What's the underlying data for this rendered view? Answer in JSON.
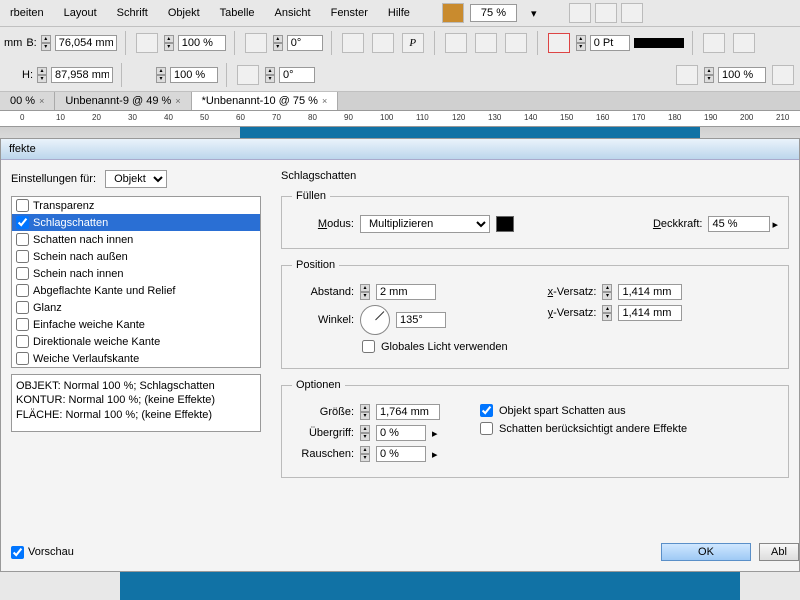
{
  "menu": [
    "rbeiten",
    "Layout",
    "Schrift",
    "Objekt",
    "Tabelle",
    "Ansicht",
    "Fenster",
    "Hilfe"
  ],
  "menubar_zoom": "75 %",
  "toolbar": {
    "B_label": "B:",
    "B_value": "76,054 mm",
    "H_label": "H:",
    "H_value": "87,958 mm",
    "mm_left": "mm",
    "scale1": "100 %",
    "scale2": "100 %",
    "rot1": "0°",
    "rot2": "0°",
    "stroke_pt": "0 Pt",
    "scale_r": "100 %"
  },
  "tabs": [
    {
      "label": "00 %",
      "active": false
    },
    {
      "label": "Unbenannt-9 @ 49 %",
      "active": false
    },
    {
      "label": "*Unbenannt-10 @ 75 %",
      "active": true
    }
  ],
  "dialog": {
    "title": "ffekte",
    "settings_for": "Einstellungen für:",
    "settings_target": "Objekt",
    "fx": [
      {
        "label": "Transparenz",
        "checked": false
      },
      {
        "label": "Schlagschatten",
        "checked": true,
        "selected": true
      },
      {
        "label": "Schatten nach innen",
        "checked": false
      },
      {
        "label": "Schein nach außen",
        "checked": false
      },
      {
        "label": "Schein nach innen",
        "checked": false
      },
      {
        "label": "Abgeflachte Kante und Relief",
        "checked": false
      },
      {
        "label": "Glanz",
        "checked": false
      },
      {
        "label": "Einfache weiche Kante",
        "checked": false
      },
      {
        "label": "Direktionale weiche Kante",
        "checked": false
      },
      {
        "label": "Weiche Verlaufskante",
        "checked": false
      }
    ],
    "summary1": "OBJEKT: Normal 100 %; Schlagschatten",
    "summary2": "KONTUR: Normal 100 %; (keine Effekte)",
    "summary3": "FLÄCHE: Normal 100 %; (keine Effekte)",
    "section_title": "Schlagschatten",
    "fill": {
      "legend": "Füllen",
      "mode_label": "Modus:",
      "mode_value": "Multiplizieren",
      "opacity_label": "Deckkraft:",
      "opacity_value": "45 %"
    },
    "position": {
      "legend": "Position",
      "distance_label": "Abstand:",
      "distance_value": "2 mm",
      "angle_label": "Winkel:",
      "angle_value": "135°",
      "global_light": "Globales Licht verwenden",
      "x_label": "x-Versatz:",
      "x_value": "1,414 mm",
      "y_label": "y-Versatz:",
      "y_value": "1,414 mm"
    },
    "options": {
      "legend": "Optionen",
      "size_label": "Größe:",
      "size_value": "1,764 mm",
      "spread_label": "Übergriff:",
      "spread_value": "0 %",
      "noise_label": "Rauschen:",
      "noise_value": "0 %",
      "knockout": "Objekt spart Schatten aus",
      "honors": "Schatten berücksichtigt andere Effekte"
    },
    "preview": "Vorschau",
    "ok": "OK",
    "cancel": "Abl"
  },
  "ruler_ticks": [
    0,
    10,
    20,
    30,
    40,
    50,
    60,
    70,
    80,
    90,
    100,
    110,
    120,
    130,
    140,
    150,
    160,
    170,
    180,
    190,
    200,
    210
  ]
}
